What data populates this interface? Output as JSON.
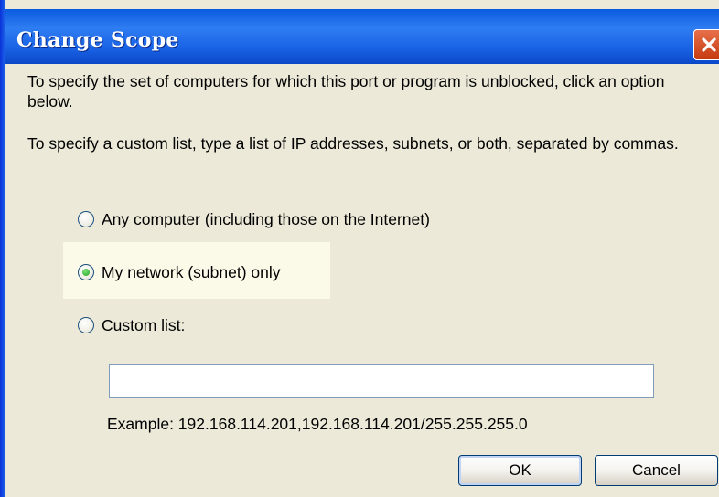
{
  "window": {
    "title": "Change Scope",
    "close_icon": "close-icon"
  },
  "intro": {
    "line1": "To specify the set of computers for which this port or program is unblocked, click an option below.",
    "line2": "To specify a custom list, type a list of IP addresses, subnets, or both, separated by commas."
  },
  "options": [
    {
      "label": "Any computer (including those on the Internet)",
      "checked": false
    },
    {
      "label": "My network (subnet) only",
      "checked": true
    },
    {
      "label": "Custom list:",
      "checked": false
    }
  ],
  "custom_list": {
    "value": "",
    "example": "Example: 192.168.114.201,192.168.114.201/255.255.255.0"
  },
  "buttons": {
    "ok": "OK",
    "cancel": "Cancel"
  },
  "colors": {
    "titlebar": "#1a63e6",
    "dialog_bg": "#ece9d8",
    "highlight": "#fbfae8",
    "close_button": "#c43a10"
  }
}
